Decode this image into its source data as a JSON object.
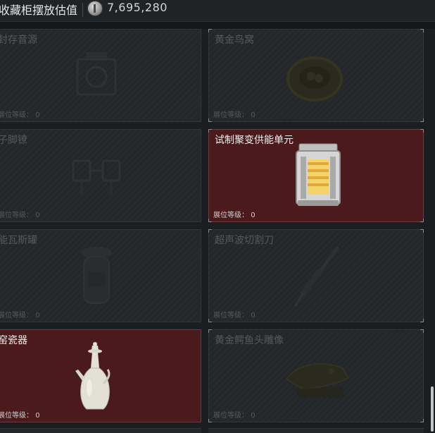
{
  "header": {
    "title": "收藏柜摆放估值",
    "value": "7,695,280",
    "coin_icon": "coin-icon"
  },
  "level_label": "展位等级：",
  "items": [
    {
      "name": "封存音源",
      "level": "0",
      "active": false,
      "icon": "sealed-sound-source-icon"
    },
    {
      "name": "黄金鸟窝",
      "level": "0",
      "active": false,
      "icon": "golden-nest-icon"
    },
    {
      "name": "子脚镣",
      "level": "0",
      "active": false,
      "icon": "shackles-icon"
    },
    {
      "name": "试制聚变供能单元",
      "level": "0",
      "active": true,
      "icon": "fusion-power-unit-icon"
    },
    {
      "name": "能瓦斯罐",
      "level": "0",
      "active": false,
      "icon": "gas-canister-icon"
    },
    {
      "name": "超声波切割刀",
      "level": "0",
      "active": false,
      "icon": "ultrasonic-cutter-icon"
    },
    {
      "name": "窑瓷器",
      "level": "0",
      "active": true,
      "icon": "porcelain-vase-icon"
    },
    {
      "name": "黄金鳄鱼头雕像",
      "level": "0",
      "active": false,
      "icon": "golden-crocodile-head-icon"
    }
  ],
  "colors": {
    "active_bg": "#4a1a1c",
    "inactive_bg": "#24272a",
    "page_bg": "#1b1e21"
  }
}
